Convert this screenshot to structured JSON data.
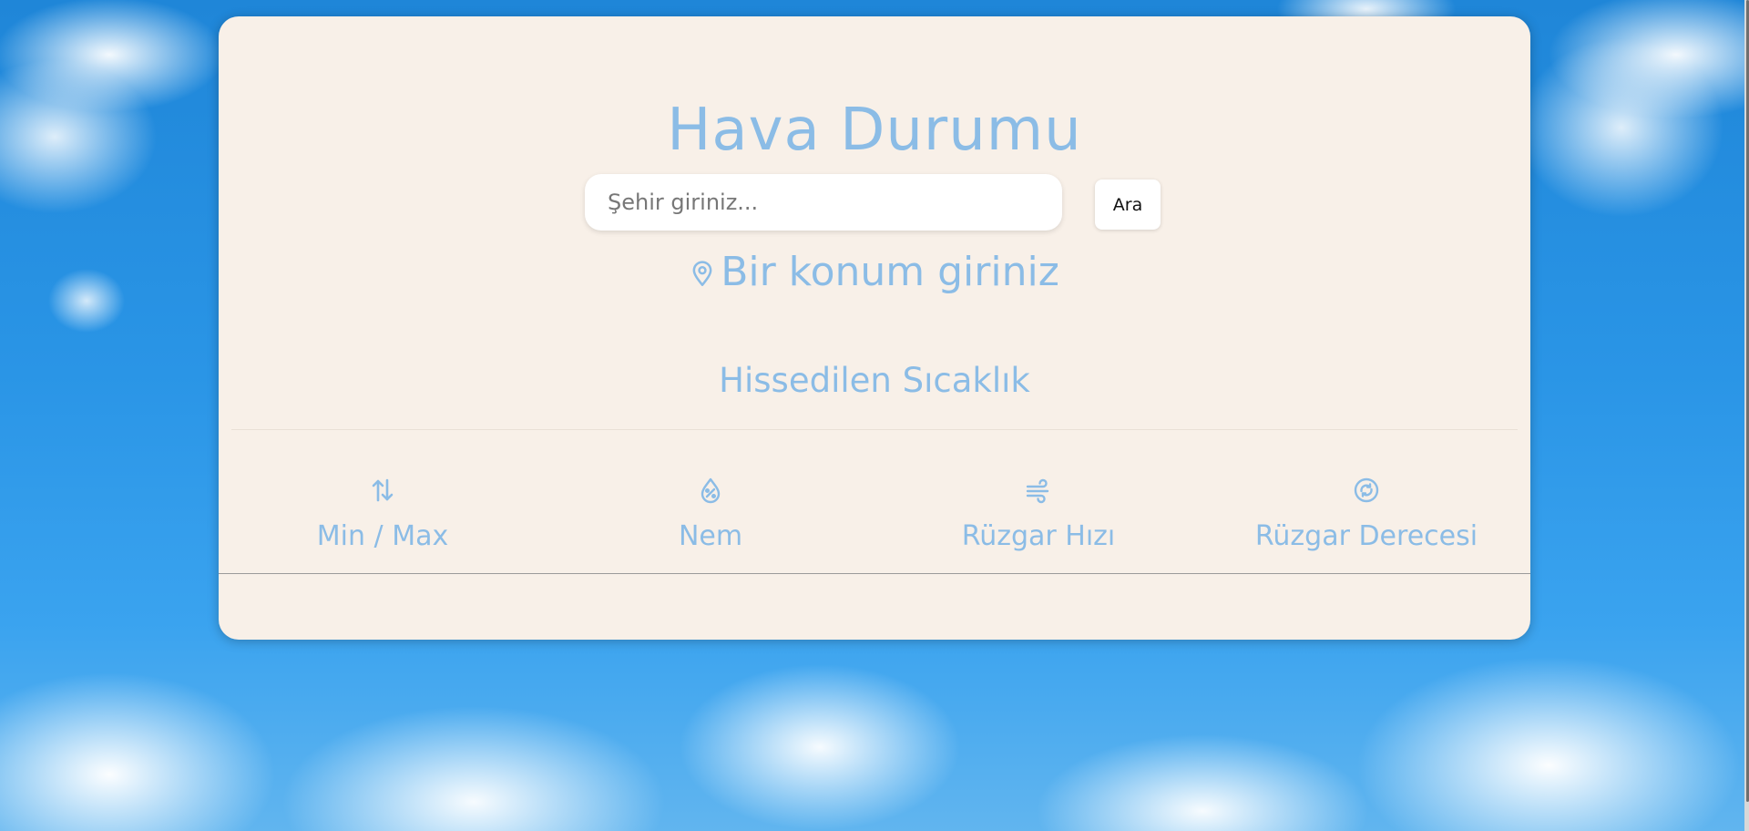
{
  "app": {
    "title": "Hava Durumu"
  },
  "search": {
    "placeholder": "Şehir giriniz...",
    "value": "",
    "button_label": "Ara"
  },
  "location": {
    "icon": "map-pin-icon",
    "text": "Bir konum giriniz"
  },
  "weather": {
    "feels_like_label": "Hissedilen Sıcaklık"
  },
  "stats": [
    {
      "icon": "arrows-up-down-icon",
      "label": "Min / Max"
    },
    {
      "icon": "humidity-drop-icon",
      "label": "Nem"
    },
    {
      "icon": "wind-icon",
      "label": "Rüzgar Hızı"
    },
    {
      "icon": "compass-cycle-icon",
      "label": "Rüzgar Derecesi"
    }
  ],
  "colors": {
    "accent": "#8bbce6",
    "card_background": "#f8f0e8",
    "sky": "#2a95e6"
  }
}
